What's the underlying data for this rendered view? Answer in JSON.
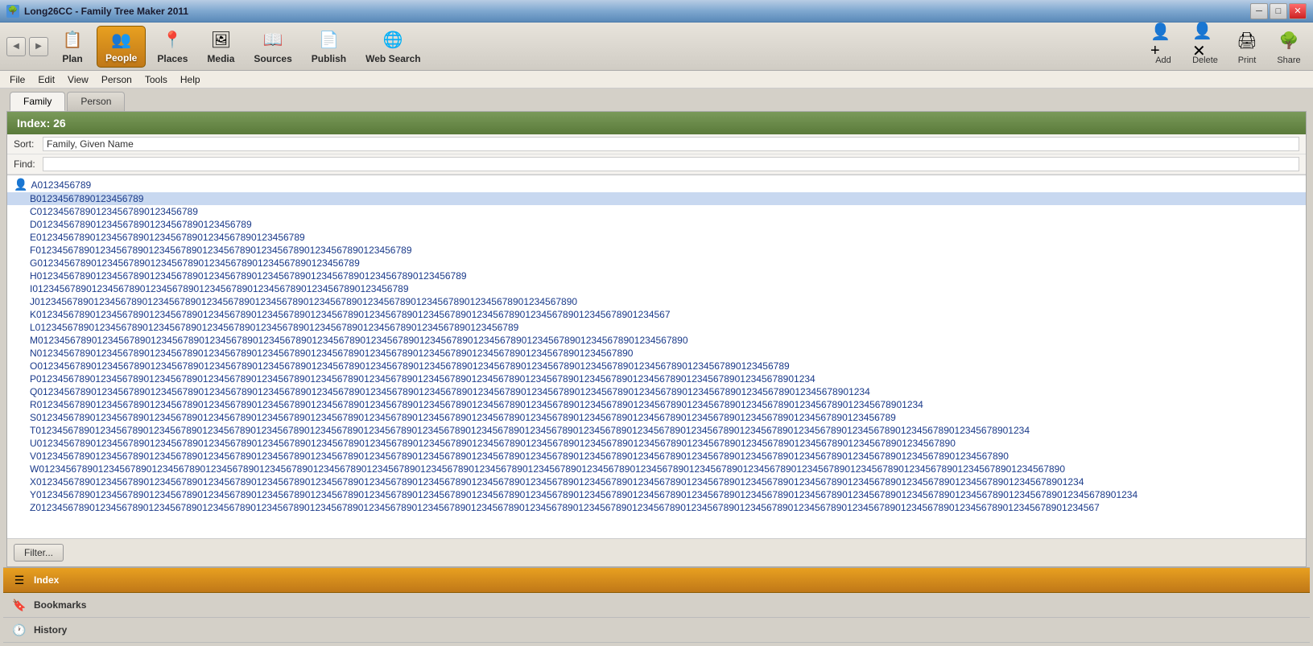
{
  "titleBar": {
    "title": "Long26CC - Family Tree Maker 2011",
    "minimizeLabel": "─",
    "maximizeLabel": "□",
    "closeLabel": "✕"
  },
  "toolbar": {
    "navBack": "◀",
    "navForward": "▶",
    "items": [
      {
        "id": "plan",
        "label": "Plan",
        "icon": "📋",
        "active": false
      },
      {
        "id": "people",
        "label": "People",
        "icon": "👥",
        "active": true
      },
      {
        "id": "places",
        "label": "Places",
        "icon": "📍",
        "active": false
      },
      {
        "id": "media",
        "label": "Media",
        "icon": "🖼",
        "active": false
      },
      {
        "id": "sources",
        "label": "Sources",
        "icon": "📖",
        "active": false
      },
      {
        "id": "publish",
        "label": "Publish",
        "icon": "📄",
        "active": false
      },
      {
        "id": "websearch",
        "label": "Web Search",
        "icon": "🌐",
        "active": false
      }
    ],
    "rightTools": [
      {
        "id": "add",
        "label": "Add",
        "icon": "👤"
      },
      {
        "id": "delete",
        "label": "Delete",
        "icon": "👤"
      },
      {
        "id": "print",
        "label": "Print",
        "icon": "🖨"
      },
      {
        "id": "share",
        "label": "Share",
        "icon": "🌳"
      }
    ]
  },
  "menubar": {
    "items": [
      "File",
      "Edit",
      "View",
      "Person",
      "Tools",
      "Help"
    ]
  },
  "tabs": [
    {
      "id": "family",
      "label": "Family",
      "active": true
    },
    {
      "id": "person",
      "label": "Person",
      "active": false
    }
  ],
  "indexPanel": {
    "title": "Index: 26",
    "sortLabel": "Sort:",
    "sortValue": "Family, Given Name",
    "findLabel": "Find:",
    "findValue": ""
  },
  "personList": [
    {
      "id": "A",
      "name": "A0123456789",
      "icon": true
    },
    {
      "id": "B",
      "name": "B01234567890123456789",
      "selected": true
    },
    {
      "id": "C",
      "name": "C012345678901234567890123456789"
    },
    {
      "id": "D",
      "name": "D0123456789012345678901234567890123456789"
    },
    {
      "id": "E",
      "name": "E01234567890123456789012345678901234567890123456789"
    },
    {
      "id": "F",
      "name": "F0123456789012345678901234567890123456789012345678901234567890123456789"
    },
    {
      "id": "G",
      "name": "G012345678901234567890123456789012345678901234567890123456789"
    },
    {
      "id": "H",
      "name": "H01234567890123456789012345678901234567890123456789012345678901234567890123456789"
    },
    {
      "id": "I",
      "name": "I0123456789012345678901234567890123456789012345678901234567890123456789"
    },
    {
      "id": "J",
      "name": "J01234567890123456789012345678901234567890123456789012345678901234567890123456789012345678901234567890"
    },
    {
      "id": "K",
      "name": "K0123456789012345678901234567890123456789012345678901234567890123456789012345678901234567890123456789012345678901234567"
    },
    {
      "id": "L",
      "name": "L012345678901234567890123456789012345678901234567890123456789012345678901234567890123456789"
    },
    {
      "id": "M",
      "name": "M0123456789012345678901234567890123456789012345678901234567890123456789012345678901234567890123456789012345678901234567890"
    },
    {
      "id": "N",
      "name": "N012345678901234567890123456789012345678901234567890123456789012345678901234567890123456789012345678901234567890"
    },
    {
      "id": "O",
      "name": "O01234567890123456789012345678901234567890123456789012345678901234567890123456789012345678901234567890123456789012345678901234567890123456789"
    },
    {
      "id": "P",
      "name": "P0123456789012345678901234567890123456789012345678901234567890123456789012345678901234567890123456789012345678901234567890123456789012345678901234"
    },
    {
      "id": "Q",
      "name": "Q01234567890123456789012345678901234567890123456789012345678901234567890123456789012345678901234567890123456789012345678901234567890123456789012345678901234"
    },
    {
      "id": "R",
      "name": "R012345678901234567890123456789012345678901234567890123456789012345678901234567890123456789012345678901234567890123456789012345678901234567890123456789012345678901234"
    },
    {
      "id": "S",
      "name": "S0123456789012345678901234567890123456789012345678901234567890123456789012345678901234567890123456789012345678901234567890123456789012345678901234567890123456789"
    },
    {
      "id": "T",
      "name": "T01234567890123456789012345678901234567890123456789012345678901234567890123456789012345678901234567890123456789012345678901234567890123456789012345678901234567890123456789012345678901234"
    },
    {
      "id": "U",
      "name": "U012345678901234567890123456789012345678901234567890123456789012345678901234567890123456789012345678901234567890123456789012345678901234567890123456789012345678901234567890"
    },
    {
      "id": "V",
      "name": "V0123456789012345678901234567890123456789012345678901234567890123456789012345678901234567890123456789012345678901234567890123456789012345678901234567890123456789012345678901234567890"
    },
    {
      "id": "W",
      "name": "W01234567890123456789012345678901234567890123456789012345678901234567890123456789012345678901234567890123456789012345678901234567890123456789012345678901234567890123456789012345678901234567890"
    },
    {
      "id": "X",
      "name": "X012345678901234567890123456789012345678901234567890123456789012345678901234567890123456789012345678901234567890123456789012345678901234567890123456789012345678901234567890123456789012345678901234"
    },
    {
      "id": "Y",
      "name": "Y0123456789012345678901234567890123456789012345678901234567890123456789012345678901234567890123456789012345678901234567890123456789012345678901234567890123456789012345678901234567890123456789012345678901234"
    },
    {
      "id": "Z",
      "name": "Z012345678901234567890123456789012345678901234567890123456789012345678901234567890123456789012345678901234567890123456789012345678901234567890123456789012345678901234567890123456789012345678901234567"
    }
  ],
  "filterButton": "Filter...",
  "bottomPanels": [
    {
      "id": "index",
      "label": "Index",
      "icon": "☰",
      "active": true
    },
    {
      "id": "bookmarks",
      "label": "Bookmarks",
      "icon": "🔖",
      "active": false
    },
    {
      "id": "history",
      "label": "History",
      "icon": "🕐",
      "active": false
    }
  ]
}
